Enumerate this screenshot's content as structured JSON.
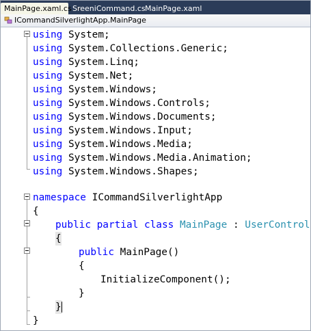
{
  "tabs": [
    {
      "label": "MainPage.xaml.cs",
      "active": true,
      "close": "✕"
    },
    {
      "label": "SreeniCommand.cs",
      "active": false
    },
    {
      "label": "MainPage.xaml",
      "active": false
    }
  ],
  "navbar": {
    "type_selector": "ICommandSilverlightApp.MainPage",
    "icon": "class-icon"
  },
  "colors": {
    "keyword": "#0000ff",
    "type": "#2b91af",
    "tab_bar": "#2b3c59",
    "active_tab": "#f6f6e8"
  },
  "code": {
    "using_keyword": "using",
    "usings": [
      "System;",
      "System.Collections.Generic;",
      "System.Linq;",
      "System.Net;",
      "System.Windows;",
      "System.Windows.Controls;",
      "System.Windows.Documents;",
      "System.Windows.Input;",
      "System.Windows.Media;",
      "System.Windows.Media.Animation;",
      "System.Windows.Shapes;"
    ],
    "namespace_keyword": "namespace",
    "namespace_name": "ICommandSilverlightApp",
    "open_brace": "{",
    "close_brace": "}",
    "class_modifiers": "public partial class",
    "class_name": "MainPage",
    "colon": ":",
    "base_class": "UserControl",
    "ctor_keyword": "public",
    "ctor_signature": "MainPage()",
    "call": "InitializeComponent();"
  }
}
